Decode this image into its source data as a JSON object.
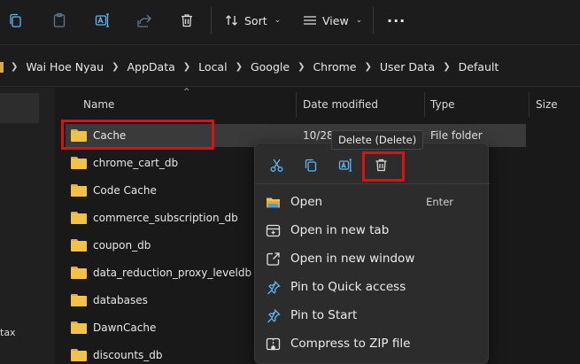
{
  "toolbar": {
    "sort_label": "Sort",
    "view_label": "View",
    "more_label": "···"
  },
  "address": {
    "crumbs": [
      "Wai Hoe Nyau",
      "AppData",
      "Local",
      "Google",
      "Chrome",
      "User Data",
      "Default"
    ]
  },
  "nav": {
    "partial_text": "tax"
  },
  "columns": {
    "name": "Name",
    "date": "Date modified",
    "type": "Type",
    "size": "Size"
  },
  "files": [
    {
      "name": "Cache",
      "date": "10/28/",
      "type": "File folder"
    },
    {
      "name": "chrome_cart_db"
    },
    {
      "name": "Code Cache"
    },
    {
      "name": "commerce_subscription_db"
    },
    {
      "name": "coupon_db"
    },
    {
      "name": "data_reduction_proxy_leveldb"
    },
    {
      "name": "databases"
    },
    {
      "name": "DawnCache"
    },
    {
      "name": "discounts_db"
    }
  ],
  "tooltip": "Delete (Delete)",
  "menu": {
    "items": [
      {
        "label": "Open",
        "accel": "Enter"
      },
      {
        "label": "Open in new tab"
      },
      {
        "label": "Open in new window"
      },
      {
        "label": "Pin to Quick access"
      },
      {
        "label": "Pin to Start"
      },
      {
        "label": "Compress to ZIP file"
      }
    ]
  },
  "colors": {
    "accent_blue": "#60b4f0",
    "highlight_red": "#e01010",
    "folder_yellow": "#f3c145"
  }
}
